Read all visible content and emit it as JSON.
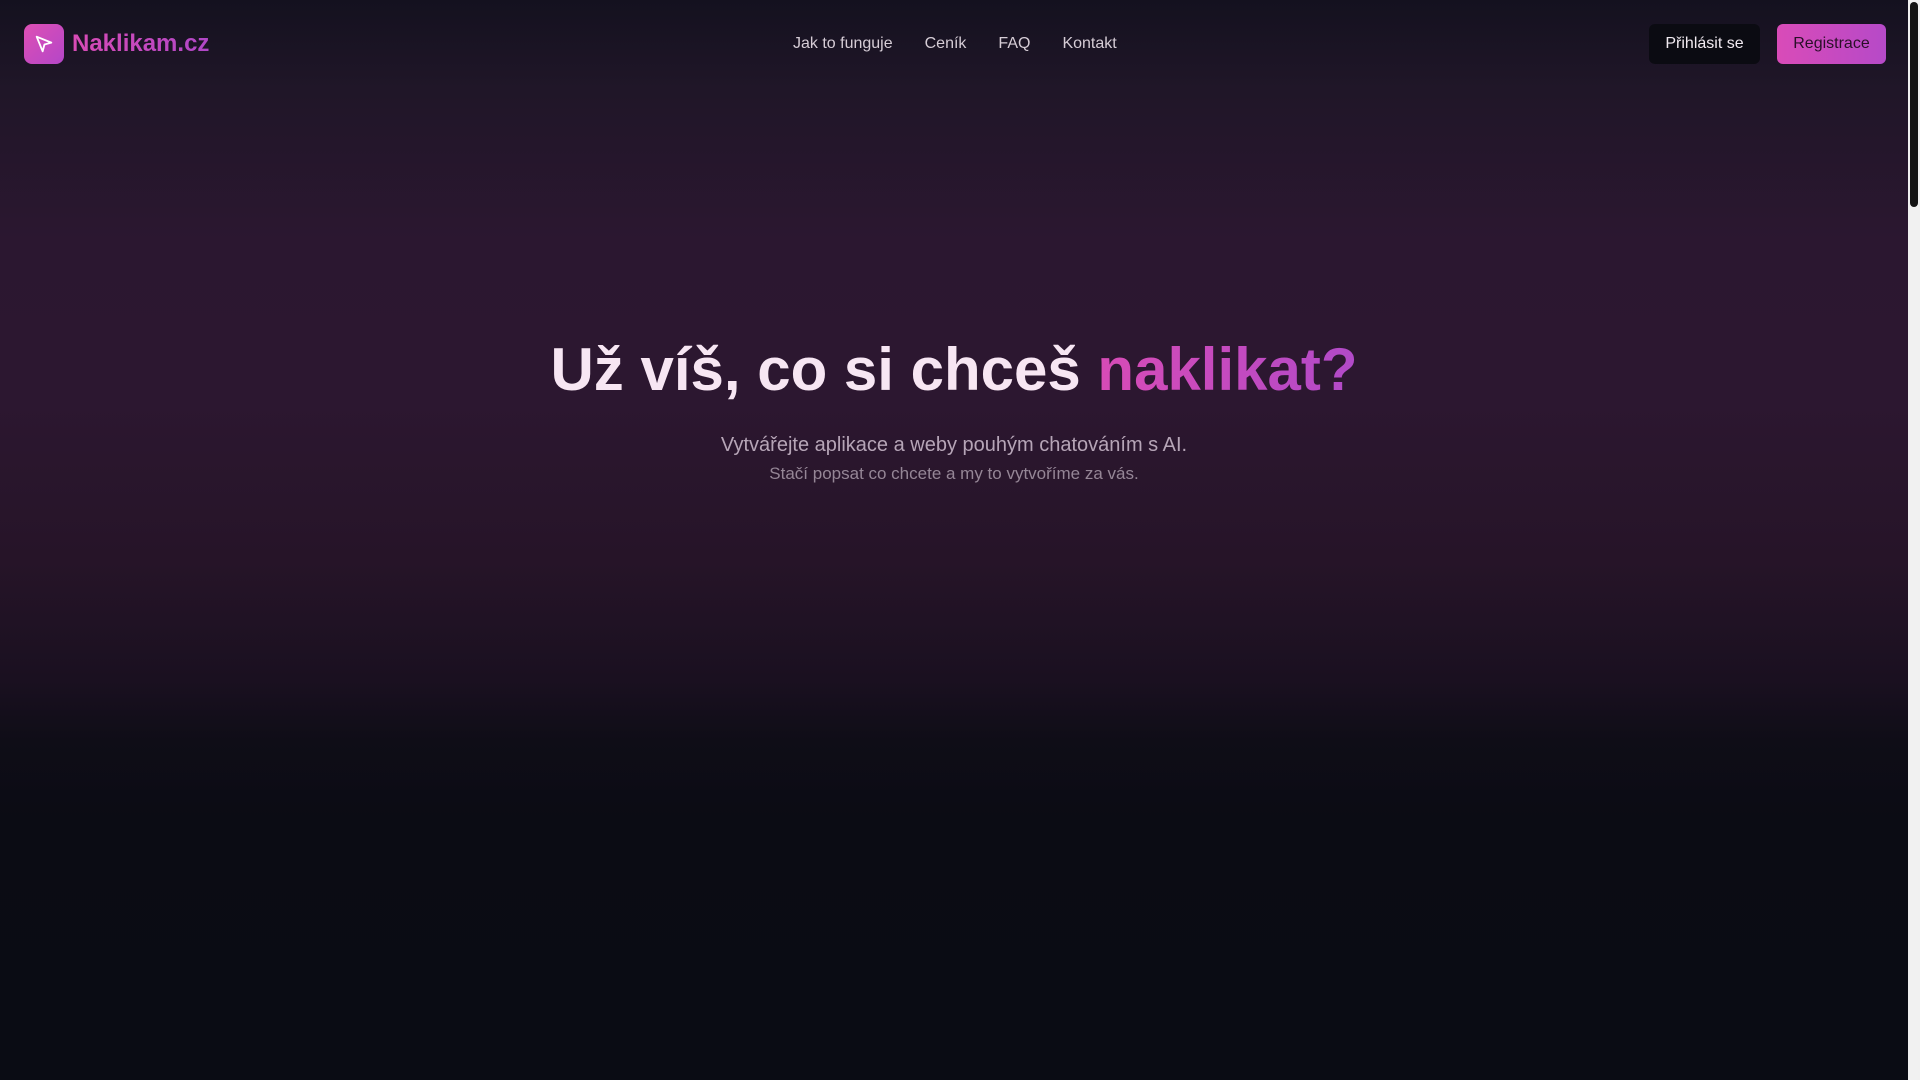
{
  "header": {
    "brand_name": "Naklikam.cz",
    "brand_icon": "cursor-arrow-icon",
    "nav": [
      {
        "label": "Jak to funguje"
      },
      {
        "label": "Ceník"
      },
      {
        "label": "FAQ"
      },
      {
        "label": "Kontakt"
      }
    ],
    "login_label": "Přihlásit se",
    "register_label": "Registrace"
  },
  "hero": {
    "title_main": "Už víš, co si chceš ",
    "title_accent": "naklikat?",
    "subtitle": "Vytvářejte aplikace a weby pouhým chatováním s AI.",
    "subtitle2": "Stačí popsat co chcete a my to vytvoříme za vás."
  },
  "colors": {
    "accent_pink": "#d94bb5",
    "accent_purple": "#b047c7",
    "background_dark": "#0a0c14"
  }
}
